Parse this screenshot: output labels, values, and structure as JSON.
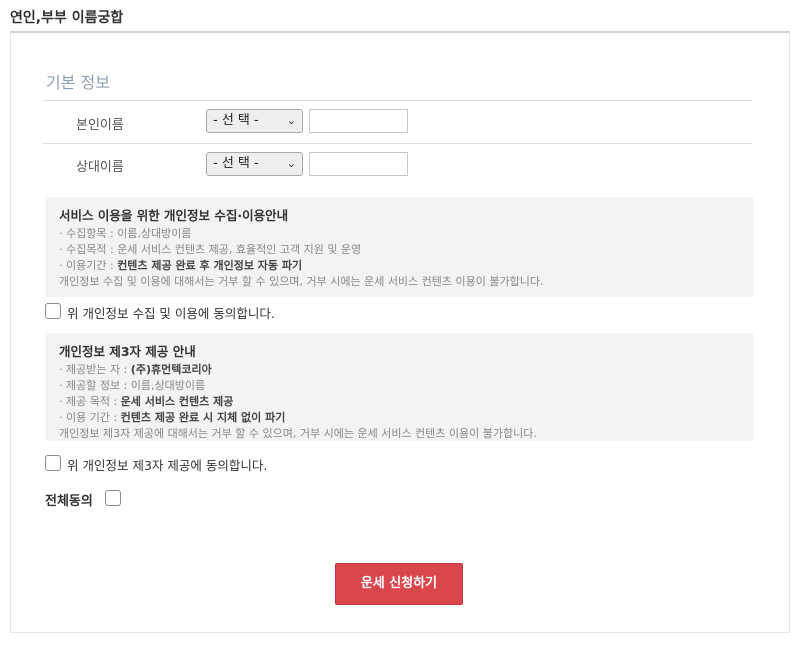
{
  "page": {
    "title": "연인,부부 이름궁합"
  },
  "basic_info": {
    "title": "기본 정보",
    "rows": [
      {
        "label": "본인이름",
        "select_value": "- 선 택 -",
        "input_value": ""
      },
      {
        "label": "상대이름",
        "select_value": "- 선 택 -",
        "input_value": ""
      }
    ]
  },
  "privacy_collect": {
    "title": "서비스 이용을 위한 개인정보 수집·이용안내",
    "item_label": "· 수집항목 : ",
    "item_value": "이름,상대방이름",
    "purpose_label": "· 수집목적 : ",
    "purpose_value": "운세 서비스 컨텐츠 제공, 효율적인 고객 지원 및 운영",
    "period_label": "· 이용기간 : ",
    "period_value": "컨텐츠 제공 완료 후 개인정보 자동 파기",
    "note": "개인정보 수집 및 이용에 대해서는 거부 할 수 있으며, 거부 시에는 운세 서비스 컨텐츠 이용이 불가합니다.",
    "agree_label": "위 개인정보 수집 및 이용에 동의합니다."
  },
  "privacy_third": {
    "title": "개인정보 제3자 제공 안내",
    "recipient_label": "· 제공받는 자 : ",
    "recipient_value": "(주)휴먼텍코리아",
    "info_label": "· 제공할 정보 : ",
    "info_value": "이름,상대방이름",
    "purpose_label": "· 제공 목적 : ",
    "purpose_value": "운세 서비스 컨텐츠 제공",
    "period_label": "· 이용 기간 : ",
    "period_value": "컨텐츠 제공 완료 시 지체 없이 파기",
    "note": "개인정보 제3자 제공에 대해서는 거부 할 수 있으며, 거부 시에는 운세 서비스 컨텐츠 이용이 불가합니다.",
    "agree_label": "위 개인정보 제3자 제공에 동의합니다."
  },
  "all_agree": {
    "label": "전체동의"
  },
  "submit": {
    "label": "운세 신청하기"
  },
  "colors": {
    "accent": "#d9474d",
    "section_title": "#8e9fb5",
    "notice_bg": "#f3f3f3"
  }
}
